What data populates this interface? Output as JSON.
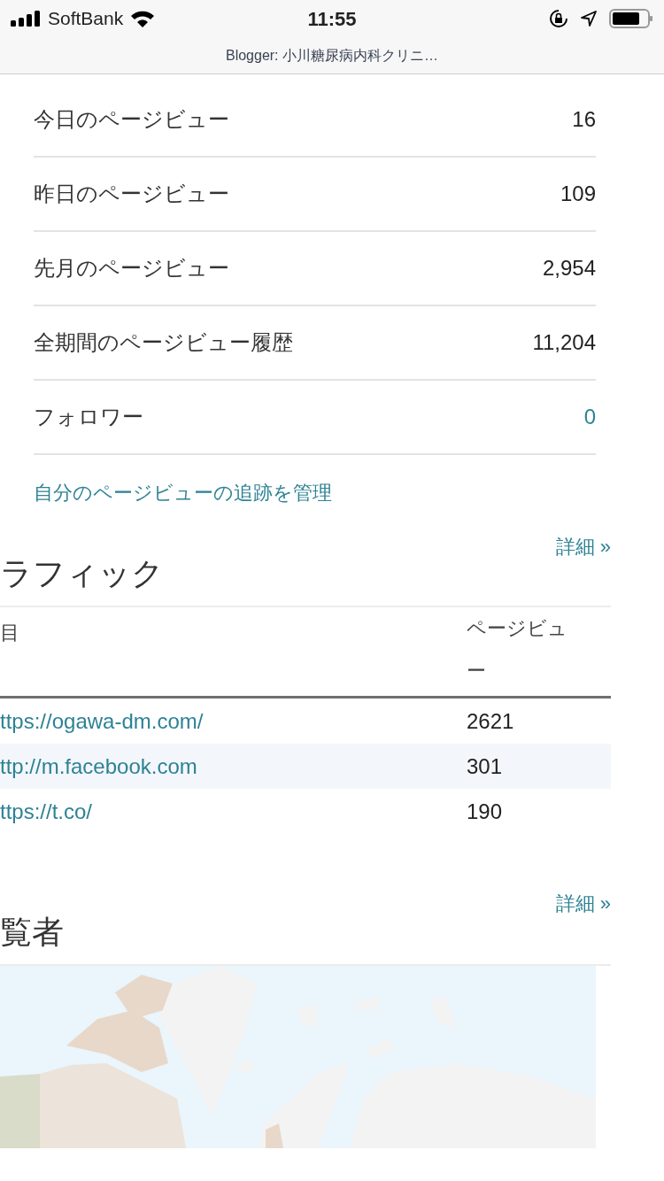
{
  "status_bar": {
    "carrier": "SoftBank",
    "time": "11:55",
    "page_title": "Blogger: 小川糖尿病内科クリニ…"
  },
  "stats": [
    {
      "label": "今日のページビュー",
      "value": "16",
      "kind": "count"
    },
    {
      "label": "昨日のページビュー",
      "value": "109",
      "kind": "count"
    },
    {
      "label": "先月のページビュー",
      "value": "2,954",
      "kind": "count"
    },
    {
      "label": "全期間のページビュー履歴",
      "value": "11,204",
      "kind": "count"
    },
    {
      "label": "フォロワー",
      "value": "0",
      "kind": "link"
    }
  ],
  "manage_link": "自分のページビューの追跡を管理",
  "traffic": {
    "details_link": "詳細 »",
    "title": "ラフィック",
    "columns": [
      "目",
      "ページビュー"
    ],
    "rows": [
      {
        "source": "ttps://ogawa-dm.com/",
        "views": "2621"
      },
      {
        "source": "ttp://m.facebook.com",
        "views": "301"
      },
      {
        "source": "ttps://t.co/",
        "views": "190"
      }
    ]
  },
  "audience": {
    "details_link": "詳細 »",
    "title": "覧者"
  }
}
